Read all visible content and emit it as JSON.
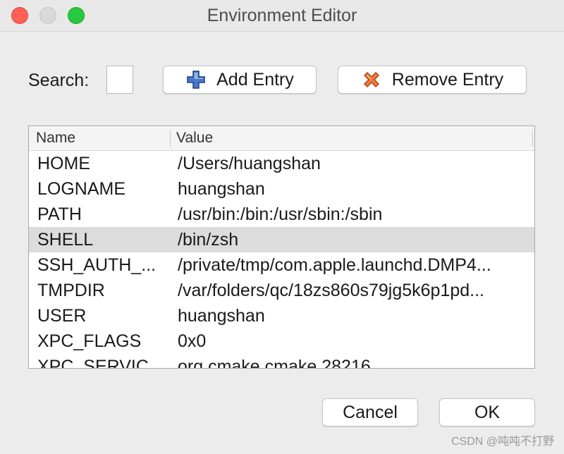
{
  "window": {
    "title": "Environment Editor"
  },
  "toolbar": {
    "search_label": "Search:",
    "search_value": "",
    "add_label": "Add Entry",
    "remove_label": "Remove Entry",
    "add_icon": "plus-icon",
    "remove_icon": "x-icon"
  },
  "table": {
    "columns": [
      "Name",
      "Value"
    ],
    "selected_row": 3,
    "rows": [
      {
        "name": "HOME",
        "value": "/Users/huangshan"
      },
      {
        "name": "LOGNAME",
        "value": "huangshan"
      },
      {
        "name": "PATH",
        "value": "/usr/bin:/bin:/usr/sbin:/sbin"
      },
      {
        "name": "SHELL",
        "value": "/bin/zsh"
      },
      {
        "name": "SSH_AUTH_...",
        "value": "/private/tmp/com.apple.launchd.DMP4..."
      },
      {
        "name": "TMPDIR",
        "value": "/var/folders/qc/18zs860s79jg5k6p1pd..."
      },
      {
        "name": "USER",
        "value": "huangshan"
      },
      {
        "name": "XPC_FLAGS",
        "value": "0x0"
      },
      {
        "name": "XPC_SERVIC",
        "value": "org.cmake.cmake.28216"
      }
    ]
  },
  "footer": {
    "cancel_label": "Cancel",
    "ok_label": "OK"
  },
  "watermark": "CSDN @吨吨不打野",
  "colors": {
    "close": "#fe5f57",
    "minimize": "#d9d9d9",
    "zoom": "#28c840",
    "selected_row": "#dcdcdc"
  }
}
